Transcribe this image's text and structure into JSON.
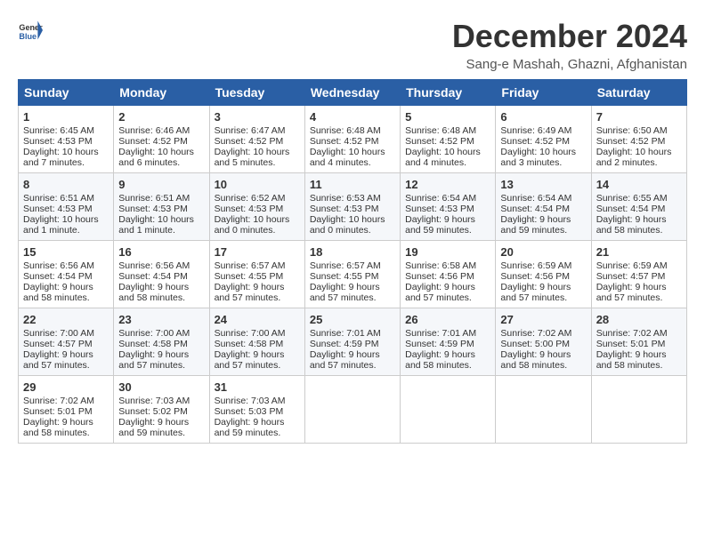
{
  "logo": {
    "general": "General",
    "blue": "Blue"
  },
  "title": "December 2024",
  "subtitle": "Sang-e Mashah, Ghazni, Afghanistan",
  "days_header": [
    "Sunday",
    "Monday",
    "Tuesday",
    "Wednesday",
    "Thursday",
    "Friday",
    "Saturday"
  ],
  "weeks": [
    [
      {
        "day": "1",
        "sunrise": "6:45 AM",
        "sunset": "4:53 PM",
        "daylight": "10 hours and 7 minutes."
      },
      {
        "day": "2",
        "sunrise": "6:46 AM",
        "sunset": "4:52 PM",
        "daylight": "10 hours and 6 minutes."
      },
      {
        "day": "3",
        "sunrise": "6:47 AM",
        "sunset": "4:52 PM",
        "daylight": "10 hours and 5 minutes."
      },
      {
        "day": "4",
        "sunrise": "6:48 AM",
        "sunset": "4:52 PM",
        "daylight": "10 hours and 4 minutes."
      },
      {
        "day": "5",
        "sunrise": "6:48 AM",
        "sunset": "4:52 PM",
        "daylight": "10 hours and 4 minutes."
      },
      {
        "day": "6",
        "sunrise": "6:49 AM",
        "sunset": "4:52 PM",
        "daylight": "10 hours and 3 minutes."
      },
      {
        "day": "7",
        "sunrise": "6:50 AM",
        "sunset": "4:52 PM",
        "daylight": "10 hours and 2 minutes."
      }
    ],
    [
      {
        "day": "8",
        "sunrise": "6:51 AM",
        "sunset": "4:53 PM",
        "daylight": "10 hours and 1 minute."
      },
      {
        "day": "9",
        "sunrise": "6:51 AM",
        "sunset": "4:53 PM",
        "daylight": "10 hours and 1 minute."
      },
      {
        "day": "10",
        "sunrise": "6:52 AM",
        "sunset": "4:53 PM",
        "daylight": "10 hours and 0 minutes."
      },
      {
        "day": "11",
        "sunrise": "6:53 AM",
        "sunset": "4:53 PM",
        "daylight": "10 hours and 0 minutes."
      },
      {
        "day": "12",
        "sunrise": "6:54 AM",
        "sunset": "4:53 PM",
        "daylight": "9 hours and 59 minutes."
      },
      {
        "day": "13",
        "sunrise": "6:54 AM",
        "sunset": "4:54 PM",
        "daylight": "9 hours and 59 minutes."
      },
      {
        "day": "14",
        "sunrise": "6:55 AM",
        "sunset": "4:54 PM",
        "daylight": "9 hours and 58 minutes."
      }
    ],
    [
      {
        "day": "15",
        "sunrise": "6:56 AM",
        "sunset": "4:54 PM",
        "daylight": "9 hours and 58 minutes."
      },
      {
        "day": "16",
        "sunrise": "6:56 AM",
        "sunset": "4:54 PM",
        "daylight": "9 hours and 58 minutes."
      },
      {
        "day": "17",
        "sunrise": "6:57 AM",
        "sunset": "4:55 PM",
        "daylight": "9 hours and 57 minutes."
      },
      {
        "day": "18",
        "sunrise": "6:57 AM",
        "sunset": "4:55 PM",
        "daylight": "9 hours and 57 minutes."
      },
      {
        "day": "19",
        "sunrise": "6:58 AM",
        "sunset": "4:56 PM",
        "daylight": "9 hours and 57 minutes."
      },
      {
        "day": "20",
        "sunrise": "6:59 AM",
        "sunset": "4:56 PM",
        "daylight": "9 hours and 57 minutes."
      },
      {
        "day": "21",
        "sunrise": "6:59 AM",
        "sunset": "4:57 PM",
        "daylight": "9 hours and 57 minutes."
      }
    ],
    [
      {
        "day": "22",
        "sunrise": "7:00 AM",
        "sunset": "4:57 PM",
        "daylight": "9 hours and 57 minutes."
      },
      {
        "day": "23",
        "sunrise": "7:00 AM",
        "sunset": "4:58 PM",
        "daylight": "9 hours and 57 minutes."
      },
      {
        "day": "24",
        "sunrise": "7:00 AM",
        "sunset": "4:58 PM",
        "daylight": "9 hours and 57 minutes."
      },
      {
        "day": "25",
        "sunrise": "7:01 AM",
        "sunset": "4:59 PM",
        "daylight": "9 hours and 57 minutes."
      },
      {
        "day": "26",
        "sunrise": "7:01 AM",
        "sunset": "4:59 PM",
        "daylight": "9 hours and 58 minutes."
      },
      {
        "day": "27",
        "sunrise": "7:02 AM",
        "sunset": "5:00 PM",
        "daylight": "9 hours and 58 minutes."
      },
      {
        "day": "28",
        "sunrise": "7:02 AM",
        "sunset": "5:01 PM",
        "daylight": "9 hours and 58 minutes."
      }
    ],
    [
      {
        "day": "29",
        "sunrise": "7:02 AM",
        "sunset": "5:01 PM",
        "daylight": "9 hours and 58 minutes."
      },
      {
        "day": "30",
        "sunrise": "7:03 AM",
        "sunset": "5:02 PM",
        "daylight": "9 hours and 59 minutes."
      },
      {
        "day": "31",
        "sunrise": "7:03 AM",
        "sunset": "5:03 PM",
        "daylight": "9 hours and 59 minutes."
      },
      null,
      null,
      null,
      null
    ]
  ]
}
